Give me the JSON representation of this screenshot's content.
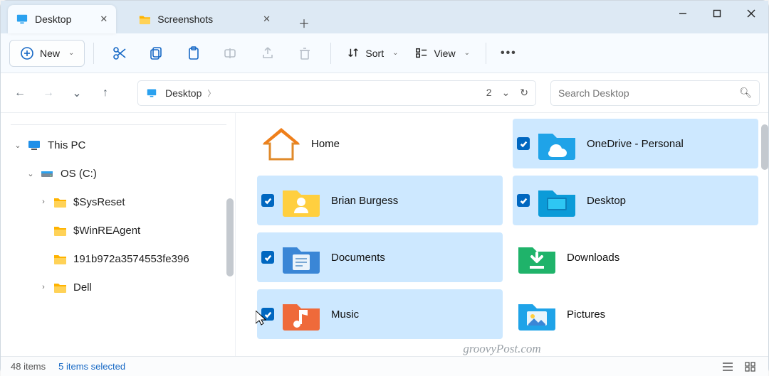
{
  "tabs": [
    {
      "label": "Desktop",
      "active": true
    },
    {
      "label": "Screenshots",
      "active": false
    }
  ],
  "toolbar": {
    "new_label": "New",
    "sort_label": "Sort",
    "view_label": "View"
  },
  "breadcrumb": {
    "segments": [
      "Desktop"
    ]
  },
  "search": {
    "placeholder": "Search Desktop"
  },
  "sidebar": {
    "nodes": [
      {
        "label": "This PC",
        "icon": "pc-icon",
        "expanded": true,
        "depth": 0
      },
      {
        "label": "OS (C:)",
        "icon": "drive-icon",
        "expanded": true,
        "depth": 1
      },
      {
        "label": "$SysReset",
        "icon": "folder-icon",
        "expanded": false,
        "depth": 2,
        "hasChildren": true
      },
      {
        "label": "$WinREAgent",
        "icon": "folder-icon",
        "expanded": false,
        "depth": 2,
        "hasChildren": false
      },
      {
        "label": "191b972a3574553fe396",
        "icon": "folder-icon",
        "expanded": false,
        "depth": 2,
        "hasChildren": false
      },
      {
        "label": "Dell",
        "icon": "folder-icon",
        "expanded": false,
        "depth": 2,
        "hasChildren": true
      }
    ]
  },
  "items": {
    "left": [
      {
        "label": "Home",
        "icon": "home-icon",
        "selected": false
      },
      {
        "label": "Brian Burgess",
        "icon": "user-folder-icon",
        "selected": true
      },
      {
        "label": "Documents",
        "icon": "documents-icon",
        "selected": true
      },
      {
        "label": "Music",
        "icon": "music-icon",
        "selected": true
      }
    ],
    "right": [
      {
        "label": "OneDrive - Personal",
        "icon": "onedrive-icon",
        "selected": true
      },
      {
        "label": "Desktop",
        "icon": "desktop-folder-icon",
        "selected": true
      },
      {
        "label": "Downloads",
        "icon": "downloads-icon",
        "selected": false
      },
      {
        "label": "Pictures",
        "icon": "pictures-icon",
        "selected": false
      }
    ]
  },
  "status": {
    "count_label": "48 items",
    "selected_label": "5 items selected"
  },
  "watermark": "groovyPost.com"
}
